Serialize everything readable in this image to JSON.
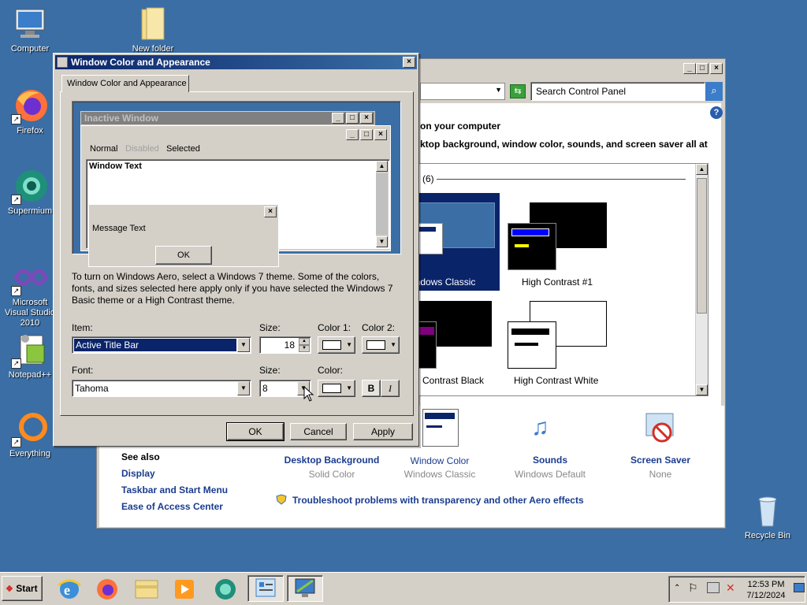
{
  "desktop": {
    "icons": [
      {
        "label": "Computer"
      },
      {
        "label": "New folder"
      },
      {
        "label": "Firefox"
      },
      {
        "label": "Supermium"
      },
      {
        "label": "Microsoft Visual Studio 2010"
      },
      {
        "label": "Notepad++"
      },
      {
        "label": "Everything"
      },
      {
        "label": "Recycle Bin"
      }
    ]
  },
  "control_panel": {
    "search_placeholder": "Search Control Panel",
    "heading": "on your computer",
    "description": "ktop background, window color, sounds, and screen saver all at",
    "group_header": "(6)",
    "themes": [
      {
        "label": "indows Classic"
      },
      {
        "label": "High Contrast #1"
      },
      {
        "label": "h Contrast Black"
      },
      {
        "label": "High Contrast White"
      }
    ],
    "bottom_items": [
      {
        "title": "Desktop Background",
        "value": "Solid Color"
      },
      {
        "title": "Window Color",
        "value": "Windows Classic"
      },
      {
        "title": "Sounds",
        "value": "Windows Default"
      },
      {
        "title": "Screen Saver",
        "value": "None"
      }
    ],
    "see_also": {
      "heading": "See also",
      "links": [
        "Display",
        "Taskbar and Start Menu",
        "Ease of Access Center"
      ]
    },
    "troubleshoot": "Troubleshoot problems with transparency and other Aero effects"
  },
  "dialog": {
    "title": "Window Color and Appearance",
    "tab": "Window Color and Appearance",
    "preview": {
      "inactive_window": "Inactive Window",
      "menu": [
        "Normal",
        "Disabled",
        "Selected"
      ],
      "window_text": "Window Text",
      "message_text": "Message Text",
      "ok": "OK"
    },
    "info": "To turn on Windows Aero, select a Windows 7 theme.  Some of the colors, fonts, and sizes selected here apply only if you have selected the Windows 7 Basic theme or a High Contrast theme.",
    "item_label": "Item:",
    "item_value": "Active Title Bar",
    "size_label": "Size:",
    "size_value": "18",
    "color1_label": "Color 1:",
    "color2_label": "Color 2:",
    "font_label": "Font:",
    "font_value": "Tahoma",
    "font_size_label": "Size:",
    "font_size_value": "8",
    "font_color_label": "Color:",
    "bold": "B",
    "italic": "I",
    "buttons": {
      "ok": "OK",
      "cancel": "Cancel",
      "apply": "Apply"
    }
  },
  "taskbar": {
    "start": "Start",
    "time": "12:53 PM",
    "date": "7/12/2024"
  },
  "colors": {
    "desktop": "#3a6ea5",
    "title_active": "#0a246a",
    "face": "#d4d0c8",
    "link": "#1a3c8f"
  }
}
